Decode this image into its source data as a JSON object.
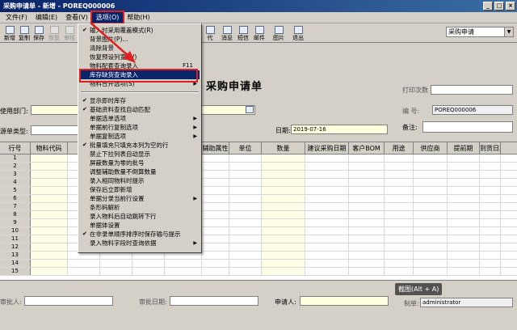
{
  "window": {
    "title": "采购申请单 - 新增 - POREQ000006",
    "buttons": [
      "_",
      "□",
      "×"
    ]
  },
  "menu": [
    {
      "label": "文件(F)"
    },
    {
      "label": "编辑(E)"
    },
    {
      "label": "查看(V)"
    },
    {
      "label": "选项(O)",
      "active": true
    },
    {
      "label": "帮助(H)"
    }
  ],
  "toolbar": {
    "left_buttons": [
      {
        "label": "新增",
        "icon": "new-icon",
        "disabled": false
      },
      {
        "label": "复制",
        "icon": "copy-icon",
        "disabled": false
      },
      {
        "label": "保存",
        "icon": "save-icon",
        "disabled": false
      },
      {
        "label": "恢复",
        "icon": "restore-icon",
        "disabled": true
      },
      {
        "label": "审核",
        "icon": "audit-icon",
        "disabled": true
      }
    ],
    "right_buttons": [
      {
        "label": "代",
        "icon": "replace-icon"
      },
      {
        "label": "消息",
        "icon": "message-icon"
      },
      {
        "label": "短信",
        "icon": "sms-icon"
      },
      {
        "label": "邮件",
        "icon": "mail-icon"
      },
      {
        "label": "图片",
        "icon": "picture-icon"
      },
      {
        "label": "退出",
        "icon": "exit-icon"
      }
    ],
    "combo_value": "采购申请"
  },
  "form": {
    "title": "采购申请单",
    "print_count_label": "打印次数",
    "dept_label": "使用部门:",
    "number_label": "编    号:",
    "number_value": "POREQ000006",
    "type_label": "源单类型:",
    "date_label": "日期:",
    "date_value": "2019-07-16",
    "remark_label": "备注:"
  },
  "grid": {
    "columns": [
      "行号",
      "物料代码",
      "",
      "",
      "",
      "",
      "辅助属性",
      "单位",
      "数量",
      "建议采购日期",
      "客户BOM",
      "用途",
      "供应商",
      "提前期",
      "到货日期"
    ],
    "rows": [
      "1",
      "2",
      "3",
      "4",
      "5",
      "6",
      "7",
      "8",
      "9",
      "10",
      "11",
      "12",
      "13",
      "14",
      "15"
    ]
  },
  "footer": {
    "approver_label": "审批人:",
    "approve_date_label": "审批日期:",
    "applicant_label": "申请人:",
    "maker_label": "制单:",
    "maker_value": "administrator",
    "screenshot_tooltip": "截图(Alt + A)"
  },
  "dropdown": {
    "items": [
      {
        "label": "输入时采用覆盖模式(R)",
        "check": true
      },
      {
        "label": "背景图片(P)..."
      },
      {
        "label": "清除背景"
      },
      {
        "label": "恢复预设列宽(W)"
      },
      {
        "label": "物料配套查询录入",
        "shortcut": "F11"
      },
      {
        "label": "库存缺货查询录入",
        "highlight": true
      },
      {
        "label": "物料合并选项(S)",
        "submenu": true
      },
      {
        "separator": true
      },
      {
        "label": "显示即时库存",
        "check": true
      },
      {
        "label": "基础资料查找自动匹配",
        "check": true
      },
      {
        "label": "单据选单选项",
        "submenu": true
      },
      {
        "label": "单据前行复制选项",
        "submenu": true
      },
      {
        "label": "单据复制选项",
        "submenu": true
      },
      {
        "label": "批量填充只填充本列为空的行",
        "check": true
      },
      {
        "label": "禁止下拉列表自动显示"
      },
      {
        "label": "屏蔽数量为零的批号"
      },
      {
        "label": "调整辅助数量不倒算数量"
      },
      {
        "label": "录入相同物料时提示"
      },
      {
        "label": "保存后立即新增"
      },
      {
        "label": "单据分录当前行设置",
        "submenu": true
      },
      {
        "label": "条形码解析"
      },
      {
        "label": "录入物料后自动跳转下行"
      },
      {
        "label": "单据体设置"
      },
      {
        "label": "在非录单顺序排序时保存输与提示",
        "check": true
      },
      {
        "label": "录入物料字段时查询依据",
        "submenu": true
      }
    ]
  }
}
